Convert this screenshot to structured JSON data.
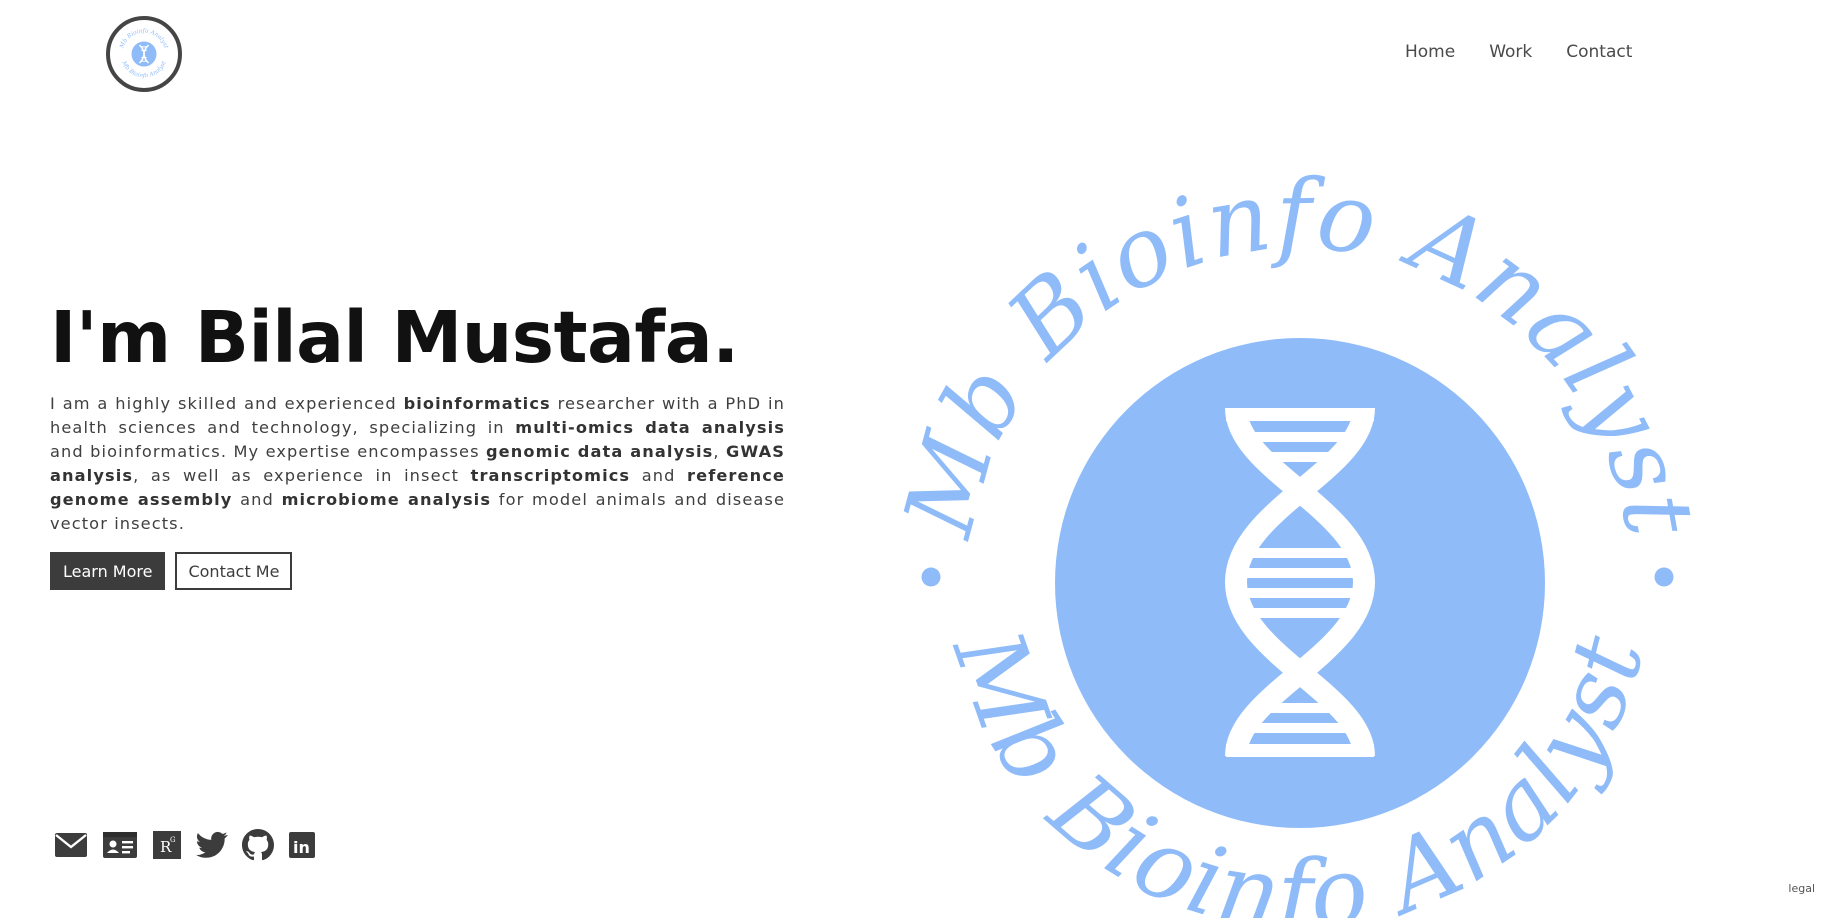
{
  "header": {
    "logo_icon": "mb-bioinfo-analyst-logo",
    "nav": [
      {
        "label": "Home"
      },
      {
        "label": "Work"
      },
      {
        "label": "Contact"
      }
    ]
  },
  "hero": {
    "title": "I'm Bilal Mustafa.",
    "intro": [
      {
        "text": "I am a highly skilled and experienced ",
        "bold": false
      },
      {
        "text": "bioinformatics",
        "bold": true
      },
      {
        "text": " researcher with a PhD in health sciences and technology, specializing in ",
        "bold": false
      },
      {
        "text": "multi-omics data analysis",
        "bold": true
      },
      {
        "text": " and bioinformatics. My expertise encompasses ",
        "bold": false
      },
      {
        "text": "genomic data analysis",
        "bold": true
      },
      {
        "text": ", ",
        "bold": false
      },
      {
        "text": "GWAS analysis",
        "bold": true
      },
      {
        "text": ", as well as experience in insect ",
        "bold": false
      },
      {
        "text": "transcriptomics",
        "bold": true
      },
      {
        "text": " and ",
        "bold": false
      },
      {
        "text": "reference genome assembly",
        "bold": true
      },
      {
        "text": " and ",
        "bold": false
      },
      {
        "text": "microbiome analysis",
        "bold": true
      },
      {
        "text": " for model animals and disease vector insects.",
        "bold": false
      }
    ],
    "buttons": {
      "learn_more": "Learn More",
      "contact_me": "Contact Me"
    },
    "art": {
      "ring_text": "Mb Bioinfo Analyst",
      "accent_color": "#8fbcf9",
      "icon": "dna-icon"
    }
  },
  "social": [
    {
      "icon": "email-icon"
    },
    {
      "icon": "id-card-icon"
    },
    {
      "icon": "researchgate-icon",
      "text": "R",
      "superscript": "G"
    },
    {
      "icon": "twitter-icon"
    },
    {
      "icon": "github-icon"
    },
    {
      "icon": "linkedin-icon",
      "text": "in"
    }
  ],
  "footer": {
    "legal": "legal"
  },
  "colors": {
    "dark": "#3c3c3c",
    "accent": "#8fbcf9",
    "text": "#3f3f3f"
  }
}
